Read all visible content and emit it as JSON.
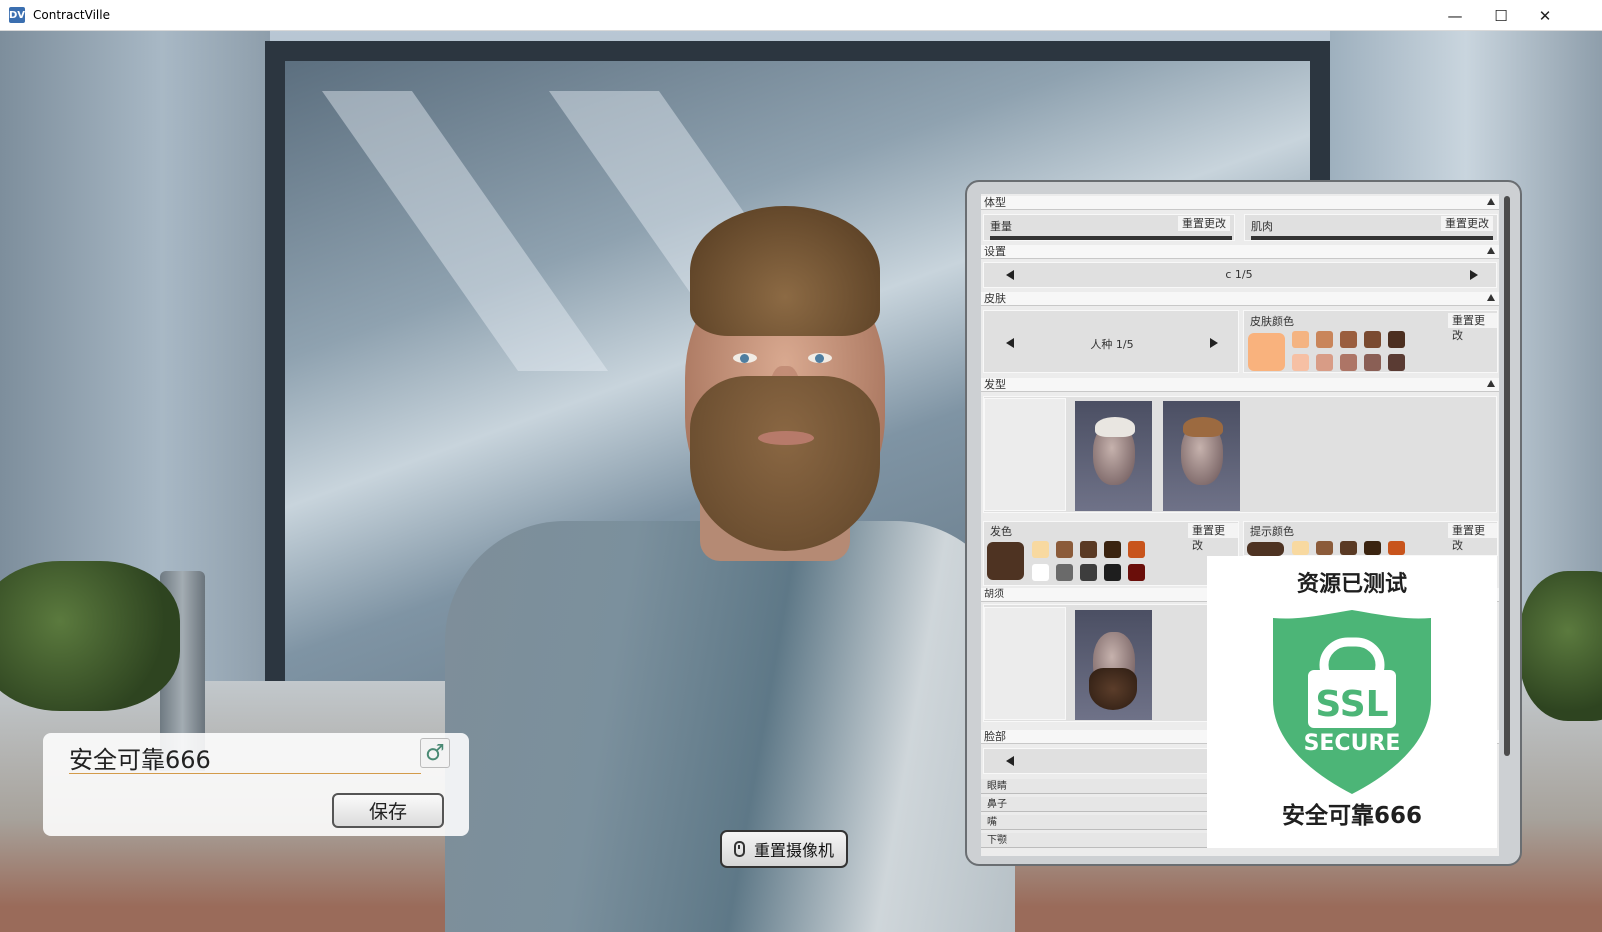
{
  "window": {
    "title": "ContractVille",
    "app_icon_text": "DV",
    "minimize_icon": "minimize-icon",
    "maximize_icon": "maximize-icon",
    "close_icon": "close-icon"
  },
  "name_box": {
    "name_value": "安全可靠666",
    "gender_symbol": "♂",
    "save_label": "保存"
  },
  "camera": {
    "reset_label": "重置摄像机"
  },
  "panel": {
    "body_section": "体型",
    "weight_label": "重量",
    "weight_reset": "重置更改",
    "muscle_label": "肌肉",
    "muscle_reset": "重置更改",
    "preset_section": "设置",
    "preset_value": "c 1/5",
    "skin_section": "皮肤",
    "race_value": "人种 1/5",
    "skin_color_label": "皮肤颜色",
    "skin_color_reset": "重置更改",
    "hair_section": "发型",
    "hair_color_label": "发色",
    "hair_color_reset": "重置更改",
    "tip_color_label": "提示颜色",
    "tip_color_reset": "重置更改",
    "beard_section": "胡须",
    "face_section": "脸部",
    "face_rows": [
      "眼睛",
      "鼻子",
      "嘴",
      "下颚"
    ]
  },
  "colors": {
    "skin_selected": "#f9b27d",
    "skin_swatches": [
      "#f4b482",
      "#c9855a",
      "#9a5e3e",
      "#7a4a30",
      "#4c2f20",
      "#f6c0a4",
      "#d89c86",
      "#ad7566",
      "#8a5f55",
      "#5a3b33"
    ],
    "hair_selected": "#4e3322",
    "hair_swatches": [
      "#f8d9a0",
      "#8b5b3a",
      "#5a3a24",
      "#3b2410",
      "#c8541c",
      "#ffffff",
      "#6a6a6a",
      "#3d3d3d",
      "#1e1e1e",
      "#6a0e0a"
    ],
    "tip_selected": "#4e3322",
    "tip_swatches": [
      "#f8d9a0",
      "#8b5b3a",
      "#5a3a24",
      "#3b2410",
      "#c8541c"
    ]
  },
  "overlay": {
    "title": "资源已测试",
    "badge_text_1": "SSL",
    "badge_text_2": "SECURE",
    "footer": "安全可靠666",
    "badge_color": "#4cb577"
  }
}
